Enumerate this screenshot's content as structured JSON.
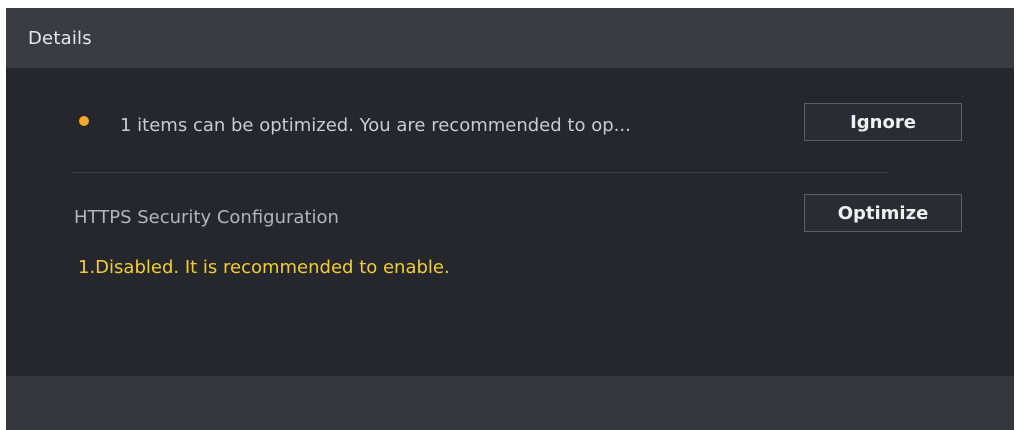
{
  "dialog": {
    "title": "Details"
  },
  "summary": {
    "status_color": "#f3a829",
    "text": "1 items can be optimized. You are recommended to op...",
    "ignore_label": "Ignore"
  },
  "items": [
    {
      "title": "HTTPS Security Configuration",
      "detail": "1.Disabled. It is recommended to enable.",
      "detail_color": "#f2ce2e",
      "action_label": "Optimize"
    }
  ]
}
